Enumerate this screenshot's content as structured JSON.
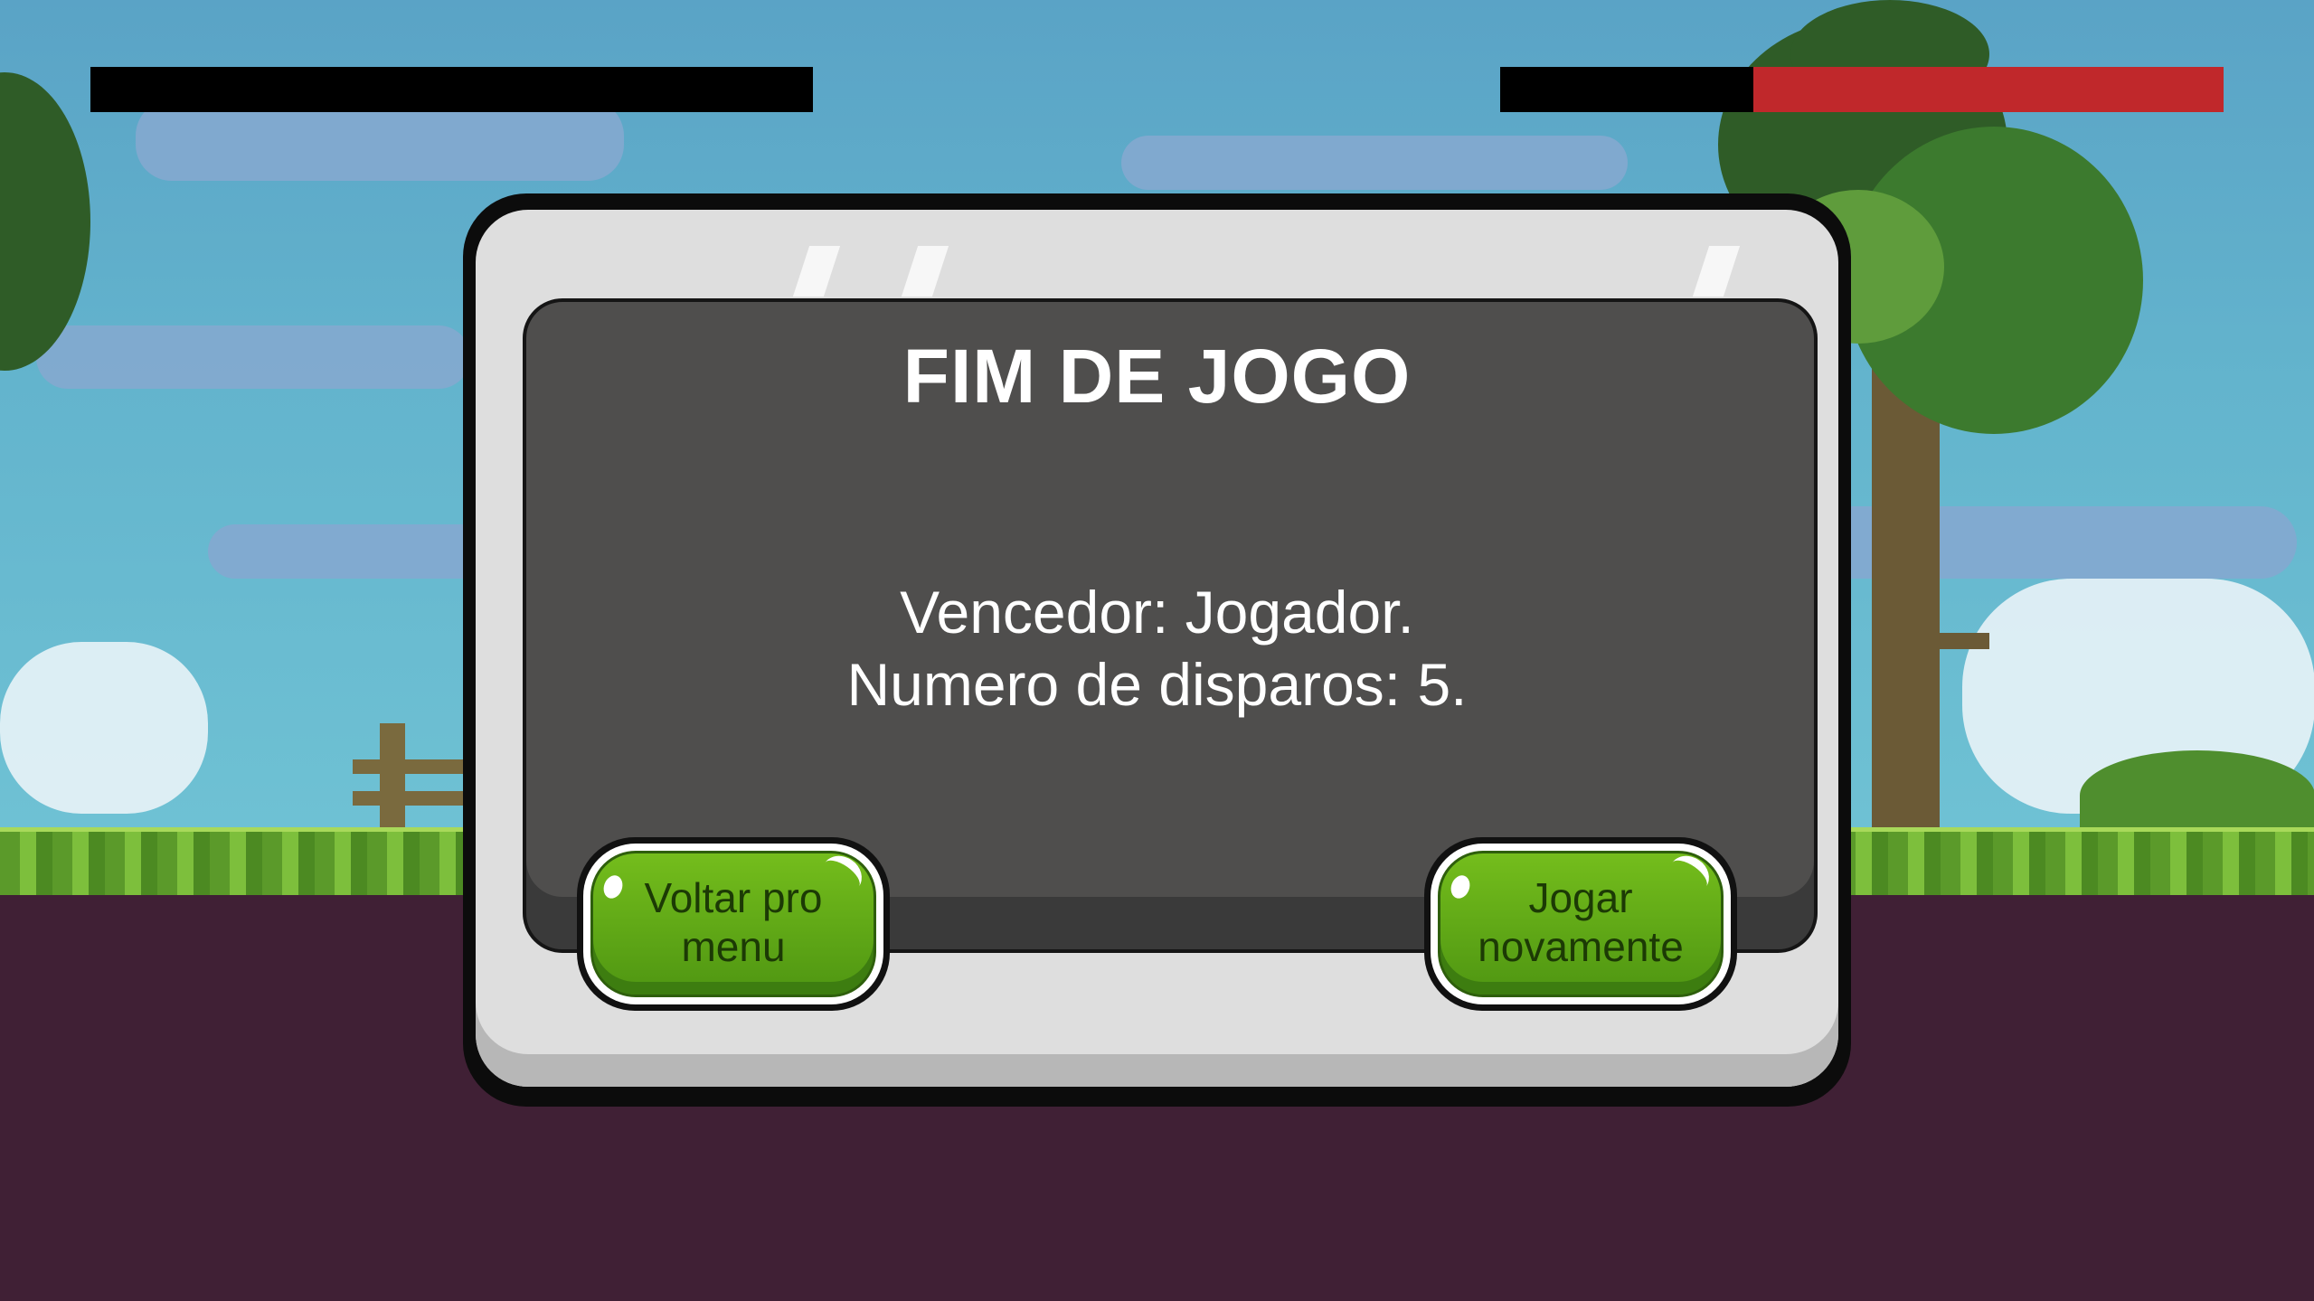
{
  "hud": {
    "player_health": {
      "fraction": 0.0,
      "fill_color": "#c0282b",
      "track_color": "#000000"
    },
    "enemy_health": {
      "fraction": 0.65,
      "fill_color": "#c0282b",
      "track_color": "#000000"
    }
  },
  "dialog": {
    "title": "FIM DE JOGO",
    "winner_text": "Vencedor: Jogador.",
    "shots_text": "Numero de disparos: 5.",
    "back_button_label": "Voltar pro\nmenu",
    "replay_button_label": "Jogar\nnovamente"
  },
  "colors": {
    "button_green": "#6ab41a",
    "panel_screen": "#4f4e4d",
    "ground": "#402035"
  }
}
